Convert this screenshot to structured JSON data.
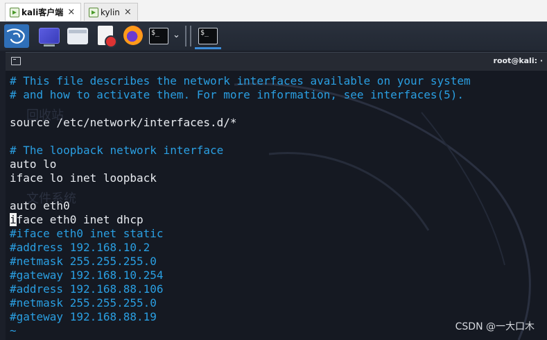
{
  "vm_tabs": [
    {
      "label": "kali客户端",
      "active": true
    },
    {
      "label": "kylin",
      "active": false
    }
  ],
  "panel": {
    "term_prompt": "$_",
    "apps": [
      "kali-menu-icon",
      "show-desktop-icon",
      "file-manager-icon",
      "text-editor-icon",
      "firefox-icon",
      "terminal-icon"
    ]
  },
  "terminal": {
    "title": "root@kali: ·",
    "lines": [
      {
        "text": "# This file describes the network interfaces available on your system",
        "kind": "comment"
      },
      {
        "text": "# and how to activate them. For more information, see interfaces(5).",
        "kind": "comment"
      },
      {
        "text": "",
        "kind": "plain"
      },
      {
        "text": "source /etc/network/interfaces.d/*",
        "kind": "plain"
      },
      {
        "text": "",
        "kind": "plain"
      },
      {
        "text": "# The loopback network interface",
        "kind": "comment"
      },
      {
        "text": "auto lo",
        "kind": "plain"
      },
      {
        "text": "iface lo inet loopback",
        "kind": "plain"
      },
      {
        "text": "",
        "kind": "plain"
      },
      {
        "text": "auto eth0",
        "kind": "plain"
      },
      {
        "text": "iface eth0 inet dhcp",
        "kind": "cursor"
      },
      {
        "text": "#iface eth0 inet static",
        "kind": "comment"
      },
      {
        "text": "#address 192.168.10.2",
        "kind": "comment"
      },
      {
        "text": "#netmask 255.255.255.0",
        "kind": "comment"
      },
      {
        "text": "#gateway 192.168.10.254",
        "kind": "comment"
      },
      {
        "text": "#address 192.168.88.106",
        "kind": "comment"
      },
      {
        "text": "#netmask 255.255.255.0",
        "kind": "comment"
      },
      {
        "text": "#gateway 192.168.88.19",
        "kind": "comment"
      },
      {
        "text": "~",
        "kind": "tilde"
      }
    ],
    "background_text": [
      "回收站",
      "文件系统"
    ]
  },
  "watermark": "CSDN @一大口木",
  "colors": {
    "comment": "#2a9fe2",
    "text": "#e9ecf1",
    "terminal_bg": "#151922",
    "panel_bg": "#2a313d",
    "accent": "#3c8bd8"
  }
}
